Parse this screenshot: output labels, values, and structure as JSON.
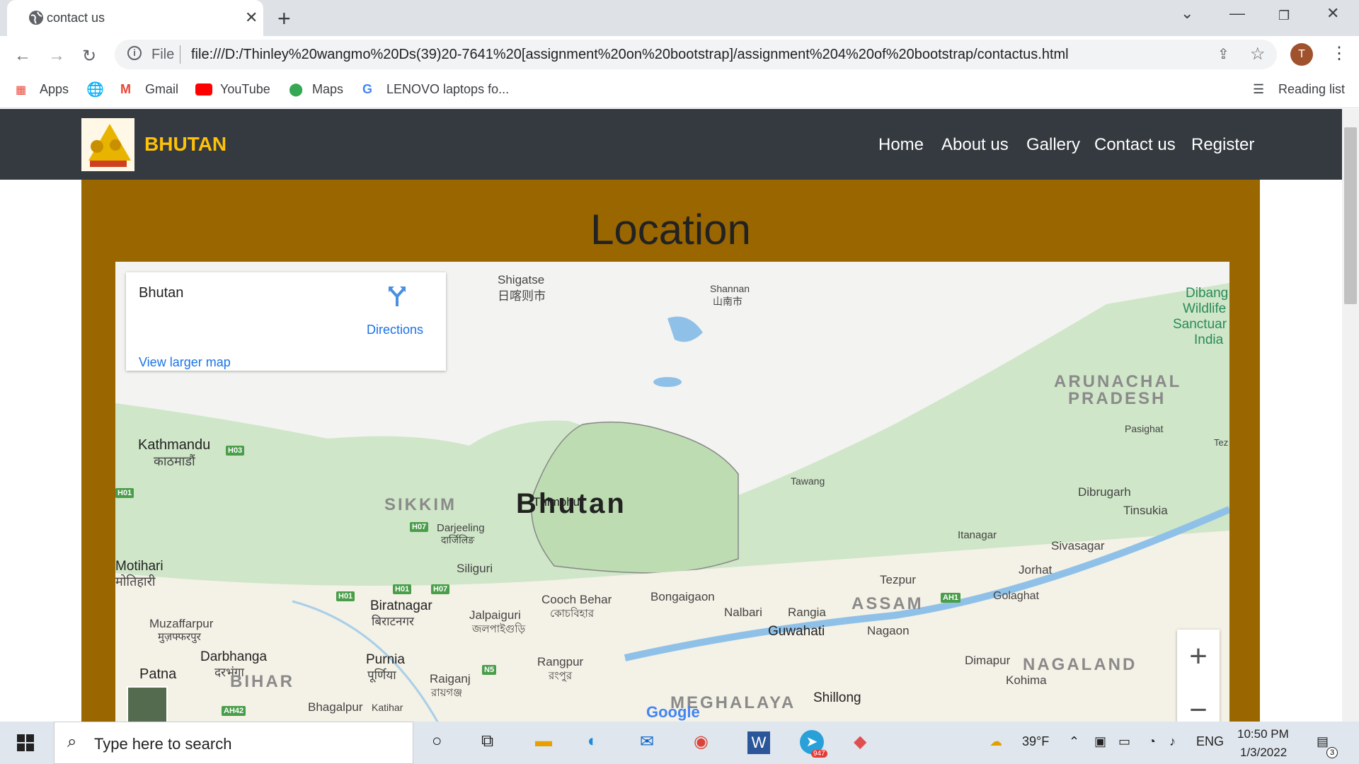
{
  "browser": {
    "tab_title": "contact us",
    "address_scheme": "File",
    "address_url": "file:///D:/Thinley%20wangmo%20Ds(39)20-7641%20[assignment%20on%20bootstrap]/assignment%204%20of%20bootstrap/contactus.html",
    "profile_initial": "T"
  },
  "bookmarks": {
    "apps": "Apps",
    "gmail": "Gmail",
    "youtube": "YouTube",
    "maps": "Maps",
    "lenovo": "LENOVO laptops fo...",
    "reading_list": "Reading list"
  },
  "site": {
    "brand": "BHUTAN",
    "nav": [
      "Home",
      "About us",
      "Gallery",
      "Contact us",
      "Register"
    ],
    "heading": "Location"
  },
  "map": {
    "place_name": "Bhutan",
    "directions": "Directions",
    "view_larger": "View larger map",
    "country_label": "Bhutan",
    "labels": [
      "Shigatse",
      "日喀则市",
      "Shannan",
      "山南市",
      "Dibang",
      "Wildlife",
      "Sanctuar",
      "India",
      "Kathmandu",
      "काठमाडौं",
      "Thimphu",
      "Tawang",
      "Darjeeling",
      "दार्जिलिङ",
      "Pasighat",
      "Dibrugarh",
      "Tinsukia",
      "Itanagar",
      "Sivasagar",
      "Siliguri",
      "Jorhat",
      "Tezpur",
      "Golaghat",
      "Bongaigaon",
      "Cooch Behar",
      "কোচবিহার",
      "Nalbari",
      "Rangia",
      "Biratnagar",
      "बिराटनगर",
      "Jalpaiguri",
      "জলপাইগুড়ি",
      "Guwahati",
      "Nagaon",
      "Motihari",
      "मोतिहारी",
      "Muzaffarpur",
      "मुज़फ्फरपुर",
      "Darbhanga",
      "दरभंगा",
      "Purnia",
      "पूर्णिया",
      "Rangpur",
      "রংপুর",
      "Raiganj",
      "রায়গঞ্জ",
      "Dimapur",
      "Kohima",
      "Patna",
      "Shillong",
      "Bhagalpur",
      "Katihar",
      "Tez"
    ],
    "regions": [
      "ARUNACHAL",
      "PRADESH",
      "SIKKIM",
      "ASSAM",
      "NAGALAND",
      "BIHAR",
      "MEGHALAYA"
    ],
    "roads": [
      "H03",
      "H01",
      "H07",
      "H01",
      "H01",
      "H07",
      "AH1",
      "N5",
      "AH42"
    ],
    "zoom_in": "+",
    "zoom_out": "−",
    "attribution": "Google"
  },
  "taskbar": {
    "search_placeholder": "Type here to search",
    "weather": "39°F",
    "language": "ENG",
    "time": "10:50 PM",
    "date": "1/3/2022",
    "telegram_badge": "947",
    "notifications": "3"
  }
}
